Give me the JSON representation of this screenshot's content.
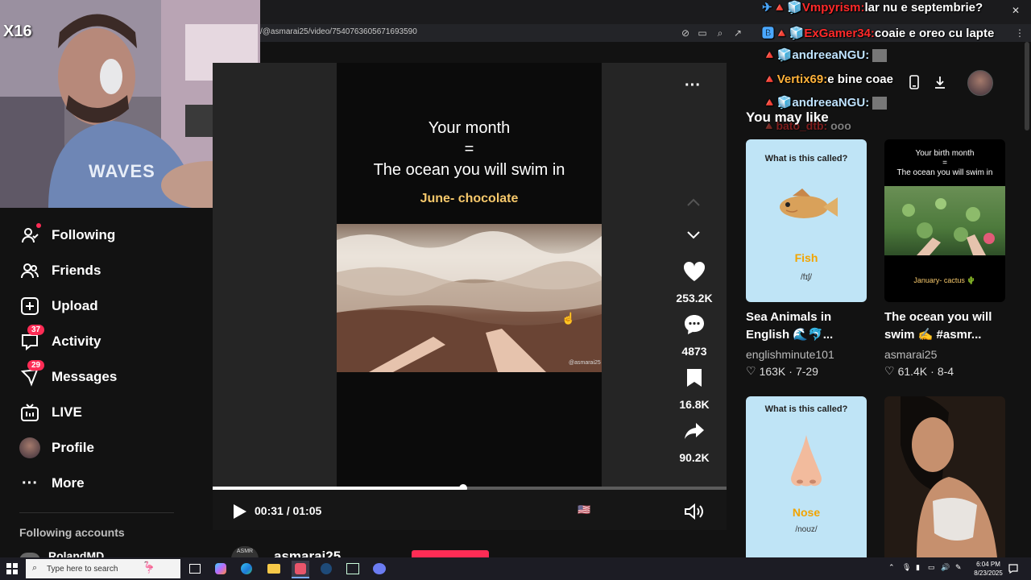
{
  "browser": {
    "url": "/@asmarai25/video/7540763605671693590"
  },
  "webcam": {
    "overlay_text": "X16",
    "shirt_text": "WAVES"
  },
  "sidebar": {
    "items": [
      {
        "label": "Following",
        "icon": "following-icon"
      },
      {
        "label": "Friends",
        "icon": "friends-icon"
      },
      {
        "label": "Upload",
        "icon": "upload-icon"
      },
      {
        "label": "Activity",
        "icon": "activity-icon",
        "badge": "37"
      },
      {
        "label": "Messages",
        "icon": "messages-icon",
        "badge": "29"
      },
      {
        "label": "LIVE",
        "icon": "live-icon"
      },
      {
        "label": "Profile",
        "icon": "profile-avatar"
      },
      {
        "label": "More",
        "icon": "more-icon"
      }
    ],
    "following_accounts_label": "Following accounts",
    "following_accounts": [
      "RolandMD"
    ]
  },
  "video": {
    "title_line1": "Your month",
    "title_line2": "=",
    "title_line3": "The ocean you will swim in",
    "subtitle": "June- chocolate",
    "watermark": "@asmarai25",
    "time_current": "00:31",
    "time_separator": "/",
    "time_total": "01:05",
    "progress": 0.487,
    "flag": "🇺🇸",
    "author_badge": "ASMR",
    "author": "asmarai25"
  },
  "actions": {
    "likes": "253.2K",
    "comments": "4873",
    "saves": "16.8K",
    "shares": "90.2K"
  },
  "you_may_like": {
    "heading": "You may like",
    "cards": [
      {
        "thumb_top": "What is this called?",
        "thumb_word": "Fish",
        "thumb_ipa": "/fɪʃ/",
        "caption_line1": "Sea Animals in",
        "caption_line2": "English 🌊🐬...",
        "author": "englishminute101",
        "likes": "163K",
        "date": "7-29"
      },
      {
        "thumb_top": "Your birth month",
        "thumb_mid": "=",
        "thumb_sub": "The ocean you will swim in",
        "thumb_bottom": "January- cactus 🌵",
        "caption_line1": "The ocean you will",
        "caption_line2": "swim ✍️ #asmr...",
        "author": "asmarai25",
        "likes": "61.4K",
        "date": "8-4"
      },
      {
        "thumb_top": "What is this called?",
        "thumb_word": "Nose",
        "thumb_ipa": "/noʊz/"
      },
      {}
    ]
  },
  "chat": [
    {
      "user": "Vmpyrism:",
      "msg": "lar nu e septembrie?",
      "color": "#ff2a2a"
    },
    {
      "user": "ExGamer34:",
      "msg": "coaie e oreo cu lapte",
      "color": "#ff2a2a"
    },
    {
      "user": "andreeaNGU:",
      "msg": "",
      "color": "#bfe3ff"
    },
    {
      "user": "Vertix69:",
      "msg": "e bine coae",
      "color": "#ffb23a"
    },
    {
      "user": "andreeaNGU:",
      "msg": "",
      "color": "#bfe3ff"
    },
    {
      "user": "bato_dtb:",
      "msg": "ooo",
      "color": "#ff2a2a"
    }
  ],
  "taskbar": {
    "search_placeholder": "Type here to search",
    "time": "6:04 PM",
    "date": "8/23/2025"
  },
  "colors": {
    "accent": "#fe2c55",
    "background": "#121212",
    "card_bg": "#bfe4f6"
  }
}
